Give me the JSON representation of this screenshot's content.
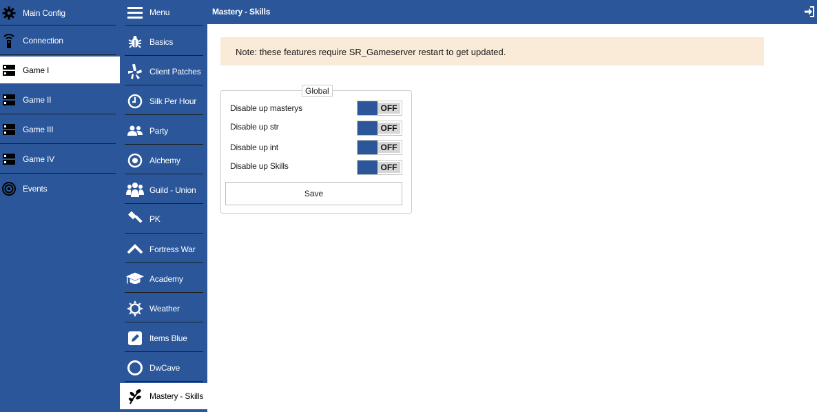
{
  "header": {
    "title": "Mastery - Skills",
    "logout_icon": "sign-in-icon"
  },
  "left_nav": {
    "items": [
      {
        "label": "Main Config",
        "icon": "gear-icon"
      },
      {
        "label": "Connection",
        "icon": "remote-icon"
      },
      {
        "label": "Game I",
        "icon": "server-icon",
        "active": true
      },
      {
        "label": "Game II",
        "icon": "server-icon"
      },
      {
        "label": "Game III",
        "icon": "server-icon"
      },
      {
        "label": "Game IV",
        "icon": "server-icon"
      },
      {
        "label": "Events",
        "icon": "target-icon"
      }
    ]
  },
  "mid_nav": {
    "items": [
      {
        "label": "Menu",
        "icon": "hamburger-icon"
      },
      {
        "label": "Basics",
        "icon": "bug-icon"
      },
      {
        "label": "Client Patches",
        "icon": "yelp-icon"
      },
      {
        "label": "Silk Per Hour",
        "icon": "clock-icon"
      },
      {
        "label": "Party",
        "icon": "users-icon"
      },
      {
        "label": "Alchemy",
        "icon": "dot-circle-icon"
      },
      {
        "label": "Guild - Union",
        "icon": "group-icon"
      },
      {
        "label": "PK",
        "icon": "gavel-icon"
      },
      {
        "label": "Fortress War",
        "icon": "chevron-up-icon"
      },
      {
        "label": "Academy",
        "icon": "graduation-cap-icon"
      },
      {
        "label": "Weather",
        "icon": "sun-icon"
      },
      {
        "label": "Items Blue",
        "icon": "pencil-square-icon"
      },
      {
        "label": "DwCave",
        "icon": "circle-icon"
      },
      {
        "label": "Mastery - Skills",
        "icon": "leaf-icon",
        "active": true
      }
    ]
  },
  "note": {
    "text": "Note: these features require SR_Gameserver restart to get updated."
  },
  "global": {
    "legend": "Global",
    "options": [
      {
        "label": "Disable up masterys",
        "state": "OFF"
      },
      {
        "label": "Disable up str",
        "state": "OFF"
      },
      {
        "label": "Disable up int",
        "state": "OFF"
      },
      {
        "label": "Disable up Skills",
        "state": "OFF"
      }
    ],
    "save_label": "Save"
  },
  "colors": {
    "nav_blue": "#2b579a",
    "note_bg": "#f9ebd8",
    "toggle_blue": "#2b579a"
  }
}
